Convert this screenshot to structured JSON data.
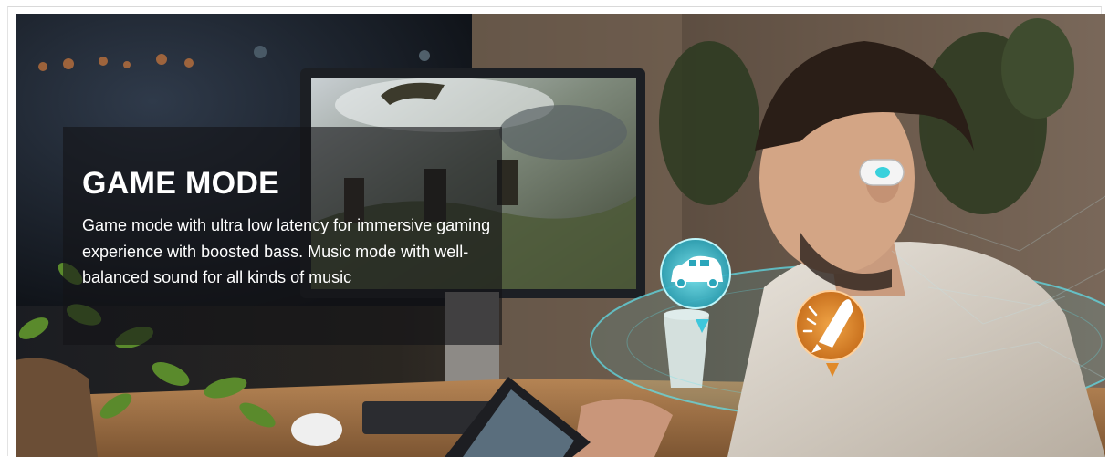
{
  "banner": {
    "title": "GAME MODE",
    "description": "Game mode with ultra low latency for immersive gaming experience with boosted bass. Music mode with well-balanced sound for all kinds of music",
    "icons": [
      "car-icon",
      "rocket-icon"
    ],
    "colors": {
      "panel_overlay": "rgba(20,20,22,0.62)",
      "car_badge": "#3fc7dc",
      "rocket_badge": "#e08a2a",
      "hologram": "#4fd6e6",
      "text": "#ffffff"
    }
  }
}
